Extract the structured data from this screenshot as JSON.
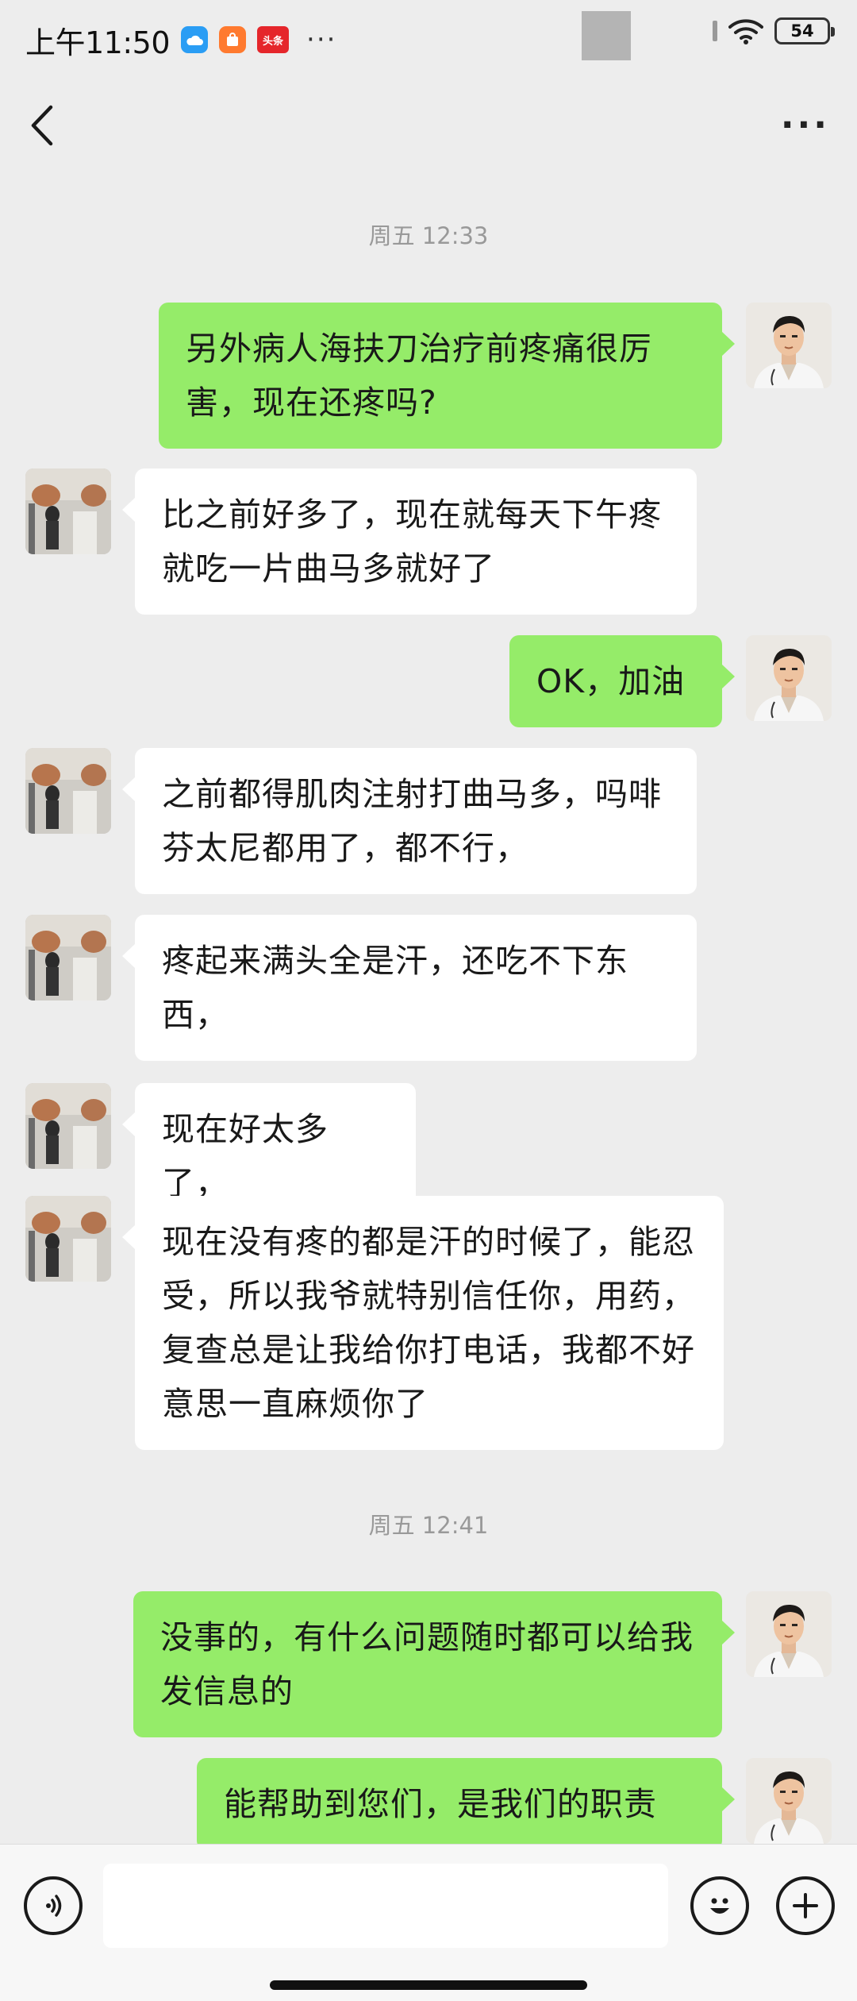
{
  "status_bar": {
    "time": "上午11:50",
    "news_badge": "头条",
    "more": "···",
    "battery": "54"
  },
  "header": {
    "title": "",
    "more": "···"
  },
  "messages": [
    {
      "type": "timestamp",
      "text": "周五 12:33"
    },
    {
      "type": "out",
      "text": "另外病人海扶刀治疗前疼痛很厉害，现在还疼吗?"
    },
    {
      "type": "in",
      "text": "比之前好多了，现在就每天下午疼 就吃一片曲马多就好了"
    },
    {
      "type": "out",
      "text": "OK，加油"
    },
    {
      "type": "in",
      "text": "之前都得肌肉注射打曲马多，吗啡 芬太尼都用了，都不行，"
    },
    {
      "type": "in",
      "text": "疼起来满头全是汗，还吃不下东西，"
    },
    {
      "type": "in",
      "text": "现在好太多了，"
    },
    {
      "type": "in",
      "text": "现在没有疼的都是汗的时候了，能忍受，所以我爷就特别信任你，用药，复查总是让我给你打电话，我都不好意思一直麻烦你了"
    },
    {
      "type": "timestamp",
      "text": "周五 12:41"
    },
    {
      "type": "out",
      "text": "没事的，有什么问题随时都可以给我发信息的"
    },
    {
      "type": "out",
      "text": "能帮助到您们，是我们的职责"
    }
  ],
  "input": {
    "placeholder": ""
  },
  "colors": {
    "background": "#ededed",
    "outgoing_bubble": "#95ec69",
    "incoming_bubble": "#ffffff"
  },
  "icons": {
    "back": "chevron-left-icon",
    "voice": "voice-icon",
    "emoji": "emoji-icon",
    "plus": "plus-icon"
  }
}
